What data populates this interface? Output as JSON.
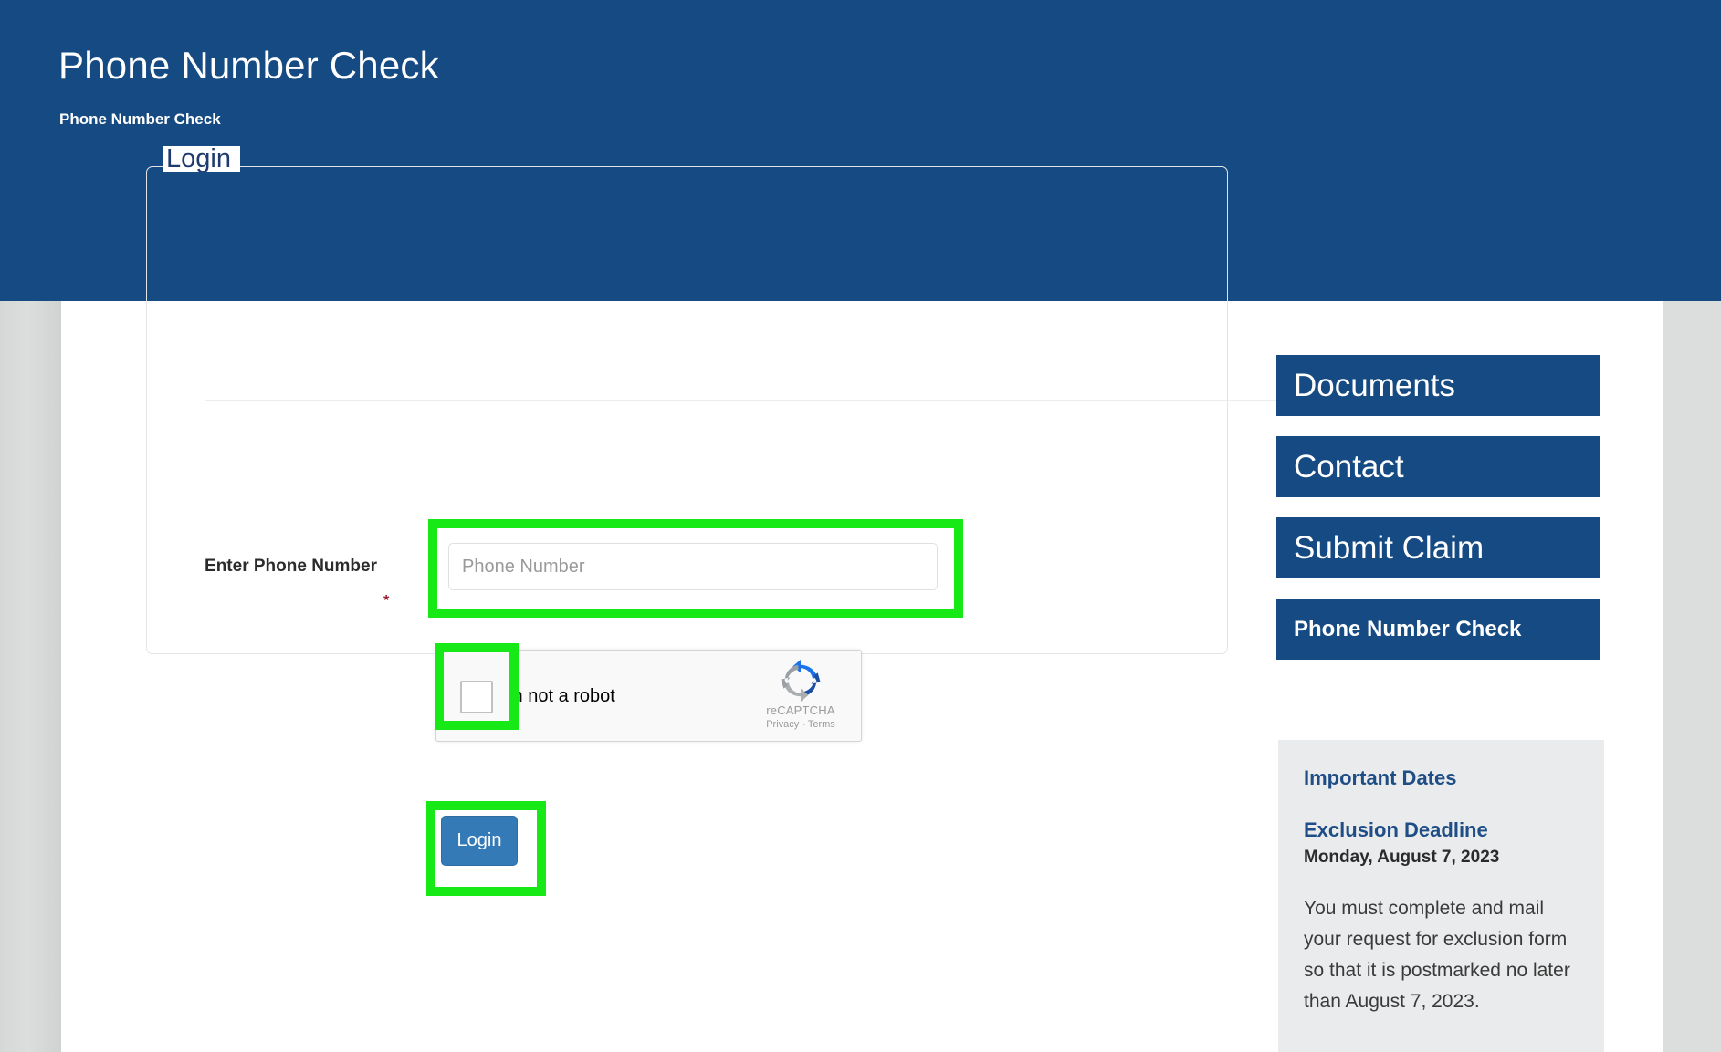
{
  "banner": {
    "title": "Phone Number Check",
    "subtitle": "Phone Number Check"
  },
  "form": {
    "legend": "Login",
    "phone_label": "Enter Phone Number",
    "required_marker": "*",
    "phone_placeholder": "Phone Number",
    "phone_value": "",
    "login_label": "Login"
  },
  "recaptcha": {
    "label": "m not a robot",
    "brand": "reCAPTCHA",
    "links": "Privacy - Terms",
    "checked": false
  },
  "sidebar": {
    "items": [
      {
        "label": "Documents"
      },
      {
        "label": "Contact"
      },
      {
        "label": "Submit Claim"
      },
      {
        "label": "Phone Number Check"
      }
    ]
  },
  "dates_panel": {
    "title": "Important Dates",
    "subtitle": "Exclusion Deadline",
    "date": "Monday, August 7, 2023",
    "body": "You must complete and mail your request for exclusion form so that it is postmarked no later than August 7, 2023."
  },
  "colors": {
    "brand_navy": "#164a82",
    "highlight_green": "#16e916",
    "button_blue": "#337ab7",
    "required_red": "#9b1c31",
    "panel_gray": "#e9ebec"
  }
}
